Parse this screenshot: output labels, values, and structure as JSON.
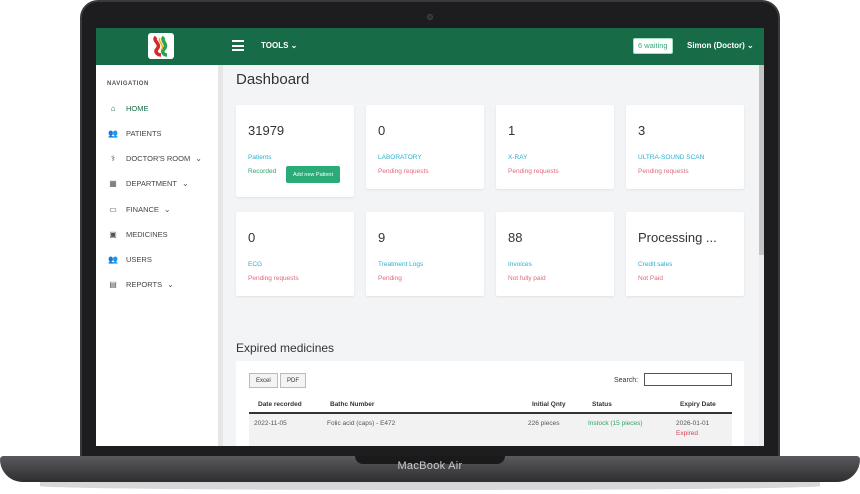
{
  "device": {
    "brand": "MacBook Air"
  },
  "topbar": {
    "tools_label": "TOOLS",
    "waiting_badge": "6 waiting",
    "user_label": "Simon (Doctor)",
    "accent": "#176b47"
  },
  "sidebar": {
    "heading": "NAVIGATION",
    "items": [
      {
        "label": "HOME",
        "icon": "home-icon",
        "active": true
      },
      {
        "label": "PATIENTS",
        "icon": "users-icon"
      },
      {
        "label": "DOCTOR'S ROOM",
        "icon": "stethoscope-icon",
        "has_dropdown": true
      },
      {
        "label": "DEPARTMENT",
        "icon": "building-icon",
        "has_dropdown": true
      },
      {
        "label": "FINANCE",
        "icon": "card-icon",
        "has_dropdown": true
      },
      {
        "label": "MEDICINES",
        "icon": "medkit-icon"
      },
      {
        "label": "USERS",
        "icon": "users-icon"
      },
      {
        "label": "REPORTS",
        "icon": "report-icon",
        "has_dropdown": true
      }
    ]
  },
  "dashboard": {
    "title": "Dashboard",
    "cards": [
      {
        "number": "31979",
        "label": "Patients",
        "sub": "Recorded",
        "button": "Add new Patient"
      },
      {
        "number": "0",
        "label": "LABORATORY",
        "sub": "Pending requests"
      },
      {
        "number": "1",
        "label": "X-RAY",
        "sub": "Pending requests"
      },
      {
        "number": "3",
        "label": "ULTRA-SOUND SCAN",
        "sub": "Pending requests"
      },
      {
        "number": "0",
        "label": "ECG",
        "sub": "Pending requests"
      },
      {
        "number": "9",
        "label": "Treatment Logs",
        "sub": "Pending"
      },
      {
        "number": "88",
        "label": "Invoices",
        "sub": "Not fully paid"
      },
      {
        "number": "Processing ...",
        "label": "Credit sales",
        "sub": "Not Paid"
      }
    ]
  },
  "expired": {
    "title": "Expired medicines",
    "excel_label": "Excel",
    "pdf_label": "PDF",
    "search_label": "Search:",
    "columns": [
      "Date recorded",
      "Bathc Number",
      "Initial Qnty",
      "Status",
      "Expiry Date"
    ],
    "rows": [
      {
        "date": "2022-11-05",
        "batch": "Folic acid (caps) - E472",
        "qty": "226 pieces",
        "status": "Instock (15 pieces)",
        "expiry": "2026-01-01",
        "expiry_note": "Expired"
      }
    ]
  }
}
